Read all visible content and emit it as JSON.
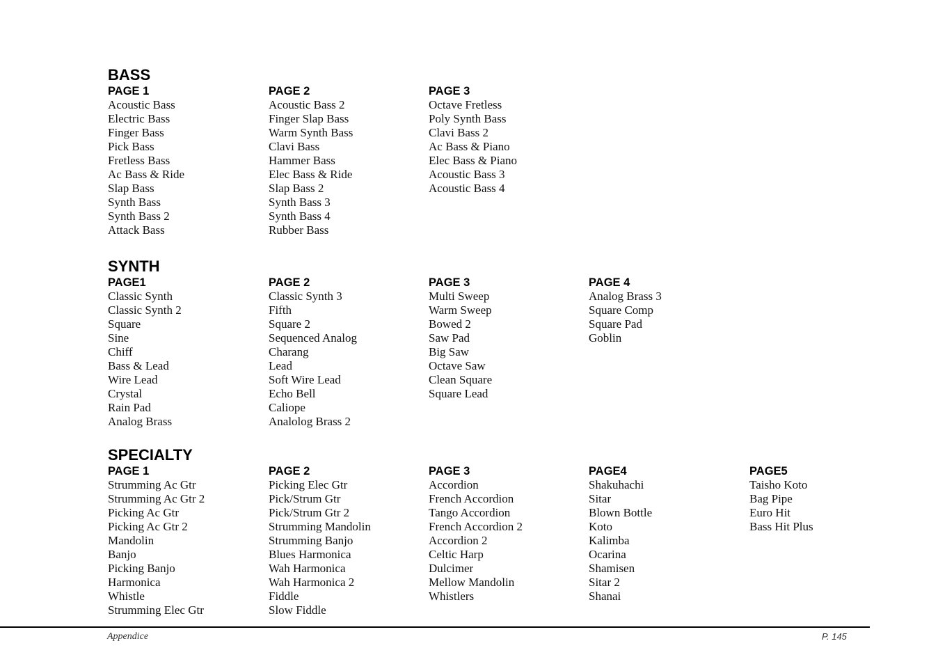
{
  "sections": [
    {
      "title": "BASS",
      "pages": [
        {
          "heading": "PAGE 1",
          "items": [
            "Acoustic Bass",
            "Electric Bass",
            "Finger Bass",
            "Pick Bass",
            "Fretless Bass",
            "Ac Bass & Ride",
            "Slap Bass",
            "Synth Bass",
            "Synth Bass 2",
            "Attack Bass"
          ]
        },
        {
          "heading": "PAGE 2",
          "items": [
            "Acoustic Bass 2",
            "Finger Slap Bass",
            "Warm Synth Bass",
            "Clavi Bass",
            "Hammer Bass",
            "Elec Bass & Ride",
            "Slap Bass 2",
            "Synth Bass 3",
            "Synth Bass 4",
            "Rubber Bass"
          ]
        },
        {
          "heading": "PAGE 3",
          "items": [
            "Octave Fretless",
            "Poly Synth Bass",
            "Clavi Bass 2",
            "Ac Bass & Piano",
            "Elec Bass & Piano",
            "Acoustic Bass 3",
            "Acoustic Bass 4"
          ]
        }
      ]
    },
    {
      "title": "SYNTH",
      "pages": [
        {
          "heading": "PAGE1",
          "items": [
            "Classic Synth",
            "Classic Synth 2",
            "Square",
            "Sine",
            "Chiff",
            "Bass & Lead",
            "Wire Lead",
            "Crystal",
            "Rain Pad",
            "Analog Brass"
          ]
        },
        {
          "heading": "PAGE 2",
          "items": [
            "Classic Synth 3",
            "Fifth",
            "Square 2",
            "Sequenced Analog",
            "Charang",
            "Lead",
            "Soft Wire Lead",
            "Echo Bell",
            "Caliope",
            "Analolog Brass 2"
          ]
        },
        {
          "heading": "PAGE 3",
          "items": [
            "Multi Sweep",
            "Warm Sweep",
            "Bowed 2",
            "Saw Pad",
            "Big Saw",
            "Octave Saw",
            "Clean Square",
            "Square Lead"
          ]
        },
        {
          "heading": "PAGE 4",
          "items": [
            "Analog Brass 3",
            "Square Comp",
            "Square Pad",
            "Goblin"
          ]
        }
      ]
    },
    {
      "title": "SPECIALTY",
      "pages": [
        {
          "heading": "PAGE 1",
          "items": [
            "Strumming Ac Gtr",
            "Strumming Ac Gtr 2",
            "Picking Ac Gtr",
            "Picking Ac Gtr 2",
            "Mandolin",
            "Banjo",
            "Picking Banjo",
            "Harmonica",
            "Whistle",
            "Strumming Elec Gtr"
          ]
        },
        {
          "heading": "PAGE 2",
          "items": [
            "Picking Elec Gtr",
            "Pick/Strum Gtr",
            "Pick/Strum Gtr 2",
            "Strumming Mandolin",
            "Strumming Banjo",
            "Blues Harmonica",
            "Wah Harmonica",
            "Wah Harmonica 2",
            "Fiddle",
            "Slow Fiddle"
          ]
        },
        {
          "heading": "PAGE 3",
          "items": [
            "Accordion",
            "French Accordion",
            "Tango Accordion",
            "French Accordion 2",
            "Accordion 2",
            "Celtic Harp",
            "Dulcimer",
            "Mellow Mandolin",
            "Whistlers"
          ]
        },
        {
          "heading": "PAGE4",
          "items": [
            "Shakuhachi",
            "Sitar",
            "Blown Bottle",
            "Koto",
            "Kalimba",
            "Ocarina",
            "Shamisen",
            "Sitar 2",
            "Shanai"
          ]
        },
        {
          "heading": "PAGE5",
          "items": [
            "Taisho Koto",
            "Bag Pipe",
            "Euro Hit",
            "Bass Hit Plus"
          ]
        }
      ]
    }
  ],
  "footer": {
    "left": "Appendice",
    "right": "P. 145"
  }
}
